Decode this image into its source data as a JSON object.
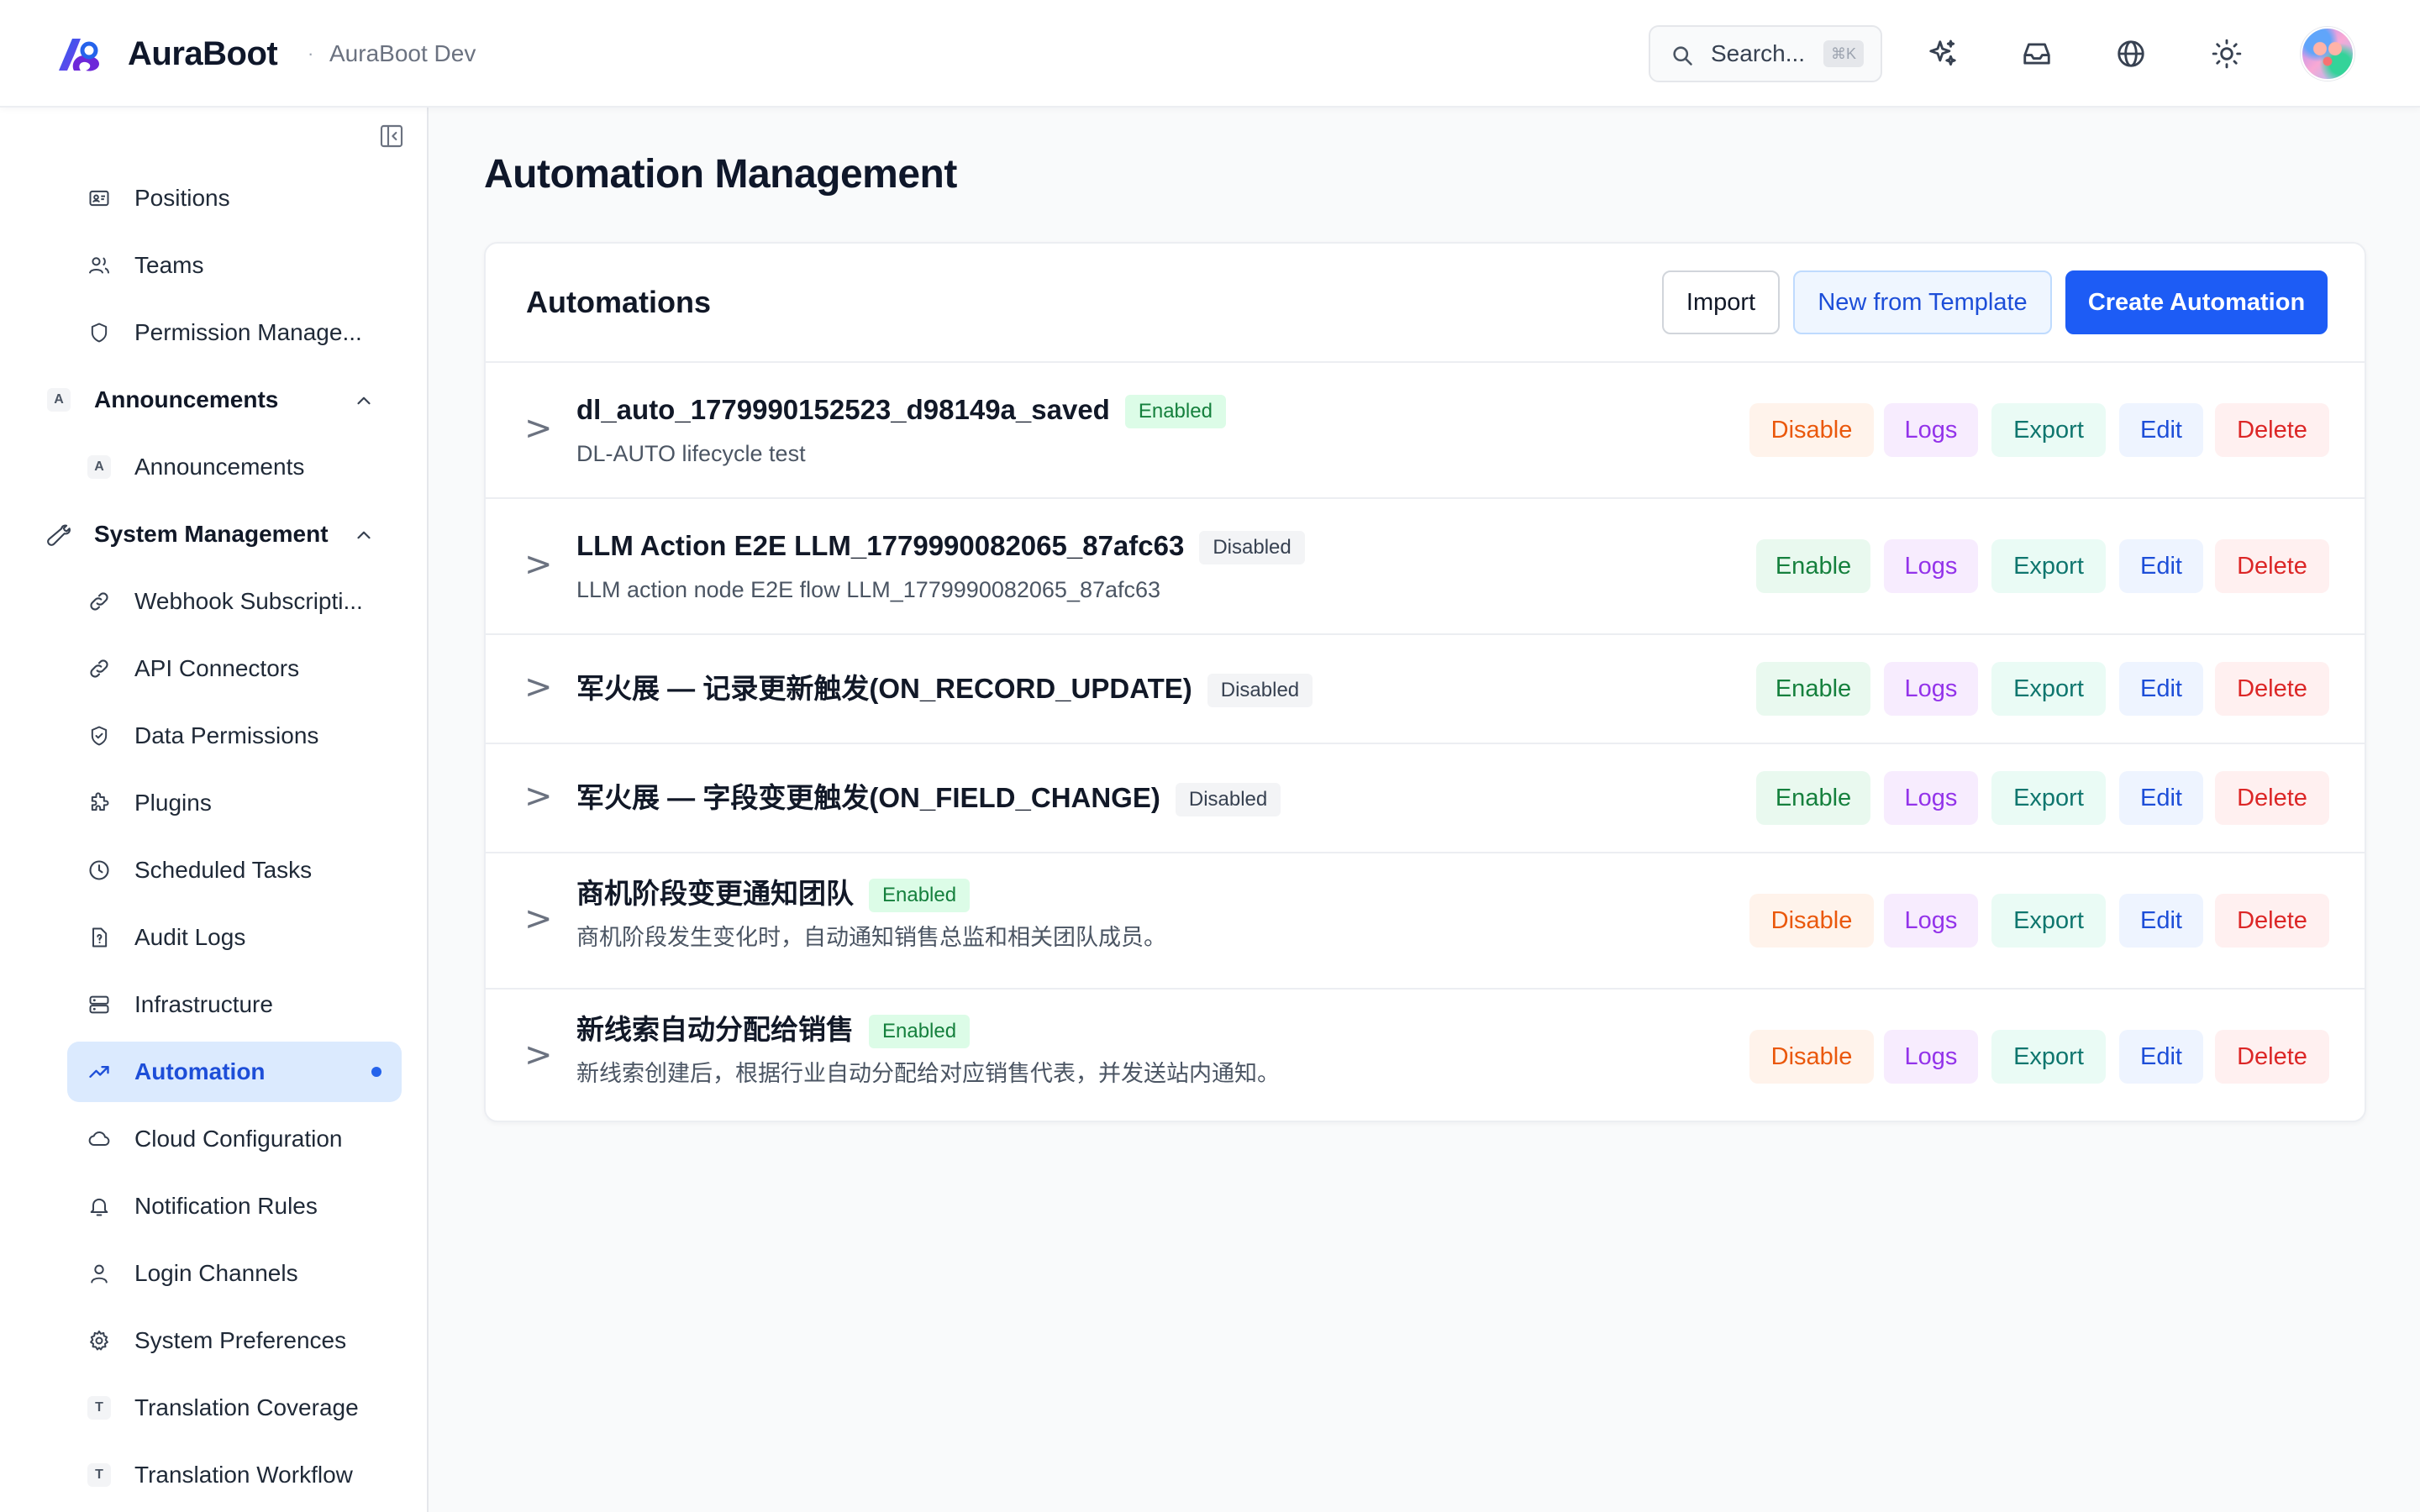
{
  "header": {
    "brand": "AuraBoot",
    "separator": "·",
    "env": "AuraBoot Dev",
    "search_placeholder": "Search...",
    "search_shortcut": "⌘K",
    "icons": [
      "sparkles-icon",
      "inbox-icon",
      "globe-icon",
      "sun-icon"
    ]
  },
  "sidebar": {
    "items": [
      {
        "label": "Positions",
        "icon": "id-card-icon"
      },
      {
        "label": "Teams",
        "icon": "users-icon"
      },
      {
        "label": "Permission Manage...",
        "icon": "shield-icon"
      }
    ],
    "group_announcements": {
      "label": "Announcements",
      "badge": "A"
    },
    "announcements_items": [
      {
        "label": "Announcements",
        "badge": "A"
      }
    ],
    "group_system": {
      "label": "System Management",
      "icon": "wrench-icon"
    },
    "system_items": [
      {
        "label": "Webhook Subscripti...",
        "icon": "link-icon"
      },
      {
        "label": "API Connectors",
        "icon": "link-icon"
      },
      {
        "label": "Data Permissions",
        "icon": "shield-check-icon"
      },
      {
        "label": "Plugins",
        "icon": "puzzle-icon"
      },
      {
        "label": "Scheduled Tasks",
        "icon": "clock-icon"
      },
      {
        "label": "Audit Logs",
        "icon": "file-question-icon"
      },
      {
        "label": "Infrastructure",
        "icon": "server-icon"
      },
      {
        "label": "Automation",
        "icon": "trending-up-icon",
        "active": true
      },
      {
        "label": "Cloud Configuration",
        "icon": "cloud-icon"
      },
      {
        "label": "Notification Rules",
        "icon": "bell-icon"
      },
      {
        "label": "Login Channels",
        "icon": "user-icon"
      },
      {
        "label": "System Preferences",
        "icon": "gear-icon"
      },
      {
        "label": "Translation Coverage",
        "badge": "T"
      },
      {
        "label": "Translation Workflow",
        "badge": "T"
      }
    ]
  },
  "main": {
    "page_title": "Automation Management",
    "card_title": "Automations",
    "buttons": {
      "import": "Import",
      "template": "New from Template",
      "create": "Create Automation"
    },
    "expand_glyph": ">",
    "actions": {
      "enable": "Enable",
      "disable": "Disable",
      "logs": "Logs",
      "export": "Export",
      "edit": "Edit",
      "delete": "Delete"
    },
    "status": {
      "enabled": "Enabled",
      "disabled": "Disabled"
    },
    "automations": [
      {
        "name": "dl_auto_1779990152523_d98149a_saved",
        "status": "Enabled",
        "description": "DL-AUTO lifecycle test"
      },
      {
        "name": "LLM Action E2E LLM_1779990082065_87afc63",
        "status": "Disabled",
        "description": "LLM action node E2E flow LLM_1779990082065_87afc63"
      },
      {
        "name": "军火展 — 记录更新触发(ON_RECORD_UPDATE)",
        "status": "Disabled",
        "description": ""
      },
      {
        "name": "军火展 — 字段变更触发(ON_FIELD_CHANGE)",
        "status": "Disabled",
        "description": ""
      },
      {
        "name": "商机阶段变更通知团队",
        "status": "Enabled",
        "description": "商机阶段发生变化时，自动通知销售总监和相关团队成员。"
      },
      {
        "name": "新线索自动分配给销售",
        "status": "Enabled",
        "description": "新线索创建后，根据行业自动分配给对应销售代表，并发送站内通知。"
      }
    ]
  },
  "colors": {
    "primary": "#1d5cf5",
    "active_bg": "#dbeafe",
    "enabled": "#15803d",
    "disable_action": "#ea580c",
    "delete_action": "#dc2626",
    "logs_action": "#9333ea"
  }
}
